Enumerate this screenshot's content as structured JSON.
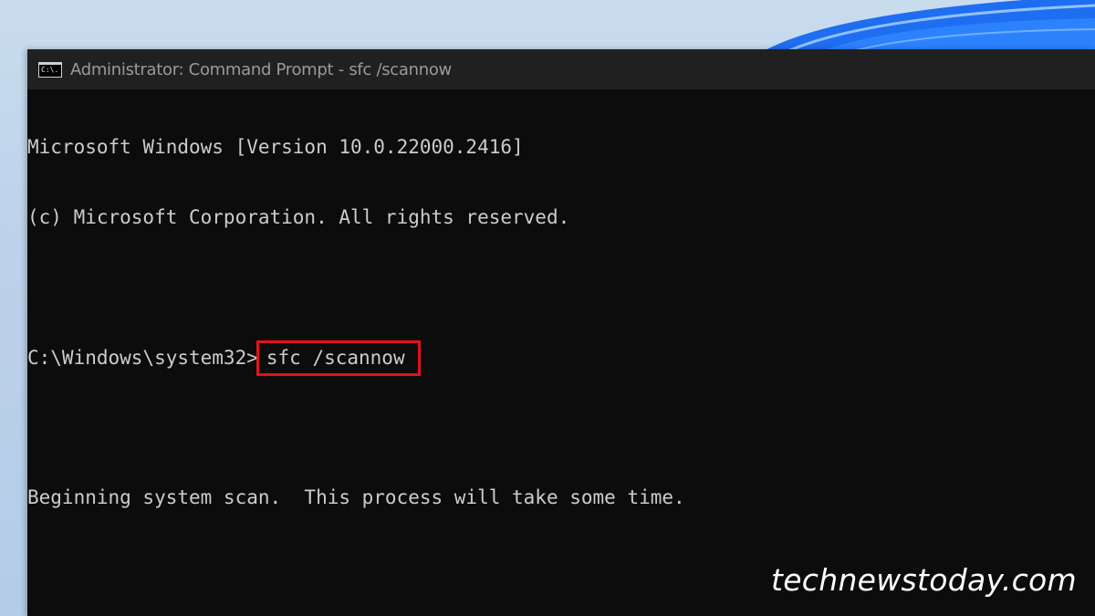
{
  "window": {
    "title": "Administrator: Command Prompt - sfc  /scannow",
    "icon": "cmd-icon",
    "icon_label": "C:\\."
  },
  "console": {
    "lines": [
      "Microsoft Windows [Version 10.0.22000.2416]",
      "(c) Microsoft Corporation. All rights reserved.",
      "",
      "Beginning system scan.  This process will take some time."
    ],
    "prompt": "C:\\Windows\\system32>",
    "command": "sfc /scannow"
  },
  "watermark": {
    "text": "technewstoday.com"
  },
  "colors": {
    "console_bg": "#0c0c0c",
    "title_bar_bg": "#202020",
    "text": "#cccccc",
    "highlight": "#e3121b",
    "wallpaper_accent": "#1e6ef0"
  }
}
